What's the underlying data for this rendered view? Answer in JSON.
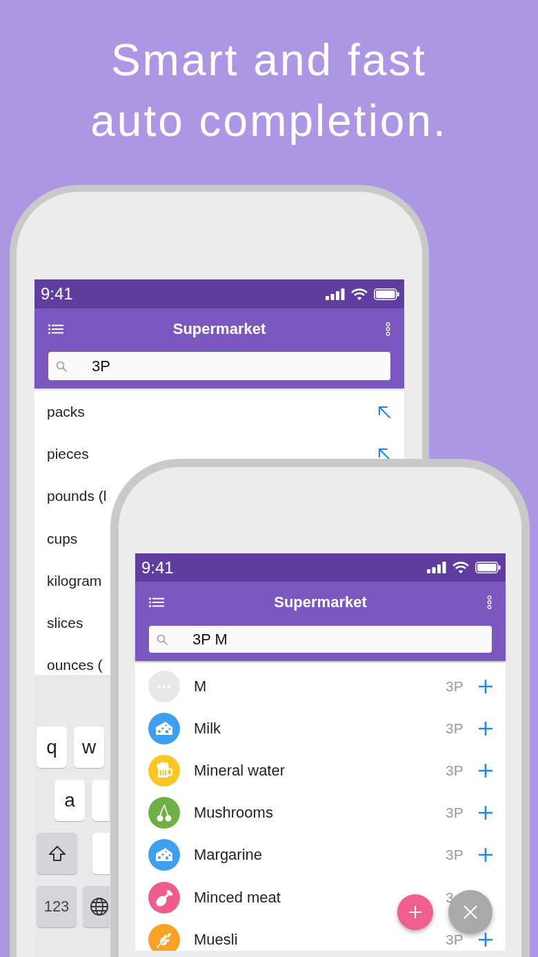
{
  "headline": "Smart and fast auto completion.",
  "back_phone": {
    "status_bar": {
      "time": "9:41"
    },
    "app_bar": {
      "title": "Supermarket"
    },
    "search": {
      "value": "3P"
    },
    "suggestions": [
      {
        "label": "packs",
        "arrow": true
      },
      {
        "label": "pieces",
        "arrow": true
      },
      {
        "label": "pounds (l",
        "arrow": false
      },
      {
        "label": "cups",
        "arrow": false
      },
      {
        "label": "kilogram",
        "arrow": false
      },
      {
        "label": "slices",
        "arrow": false
      },
      {
        "label": "ounces (",
        "arrow": false
      }
    ],
    "keyboard": {
      "rows": [
        [
          {
            "kind": "letter",
            "label": "q"
          },
          {
            "kind": "letter",
            "label": "w"
          }
        ],
        [
          {
            "kind": "letter",
            "label": "a"
          },
          {
            "kind": "blank"
          }
        ],
        [
          {
            "kind": "shift"
          },
          {
            "kind": "blank"
          }
        ],
        [
          {
            "kind": "mode",
            "label": "123"
          },
          {
            "kind": "globe"
          }
        ]
      ]
    }
  },
  "front_phone": {
    "status_bar": {
      "time": "9:41"
    },
    "app_bar": {
      "title": "Supermarket"
    },
    "search": {
      "value": "3P M"
    },
    "items": [
      {
        "kind": "custom",
        "color": "#e8e8e8",
        "name": "M",
        "qty": "3P",
        "plus": true
      },
      {
        "kind": "dairy",
        "color": "#3d9ff0",
        "name": "Milk",
        "qty": "3P",
        "plus": true
      },
      {
        "kind": "drinks",
        "color": "#f9c623",
        "name": "Mineral water",
        "qty": "3P",
        "plus": true
      },
      {
        "kind": "produce",
        "color": "#6faf45",
        "name": "Mushrooms",
        "qty": "3P",
        "plus": true
      },
      {
        "kind": "dairy",
        "color": "#3d9ff0",
        "name": "Margarine",
        "qty": "3P",
        "plus": true
      },
      {
        "kind": "meat",
        "color": "#ec5d8c",
        "name": "Minced meat",
        "qty": "3",
        "plus": false
      },
      {
        "kind": "cereal",
        "color": "#f7a125",
        "name": "Muesli",
        "qty": "3P",
        "plus": true
      }
    ],
    "fabs": [
      {
        "kind": "add"
      },
      {
        "kind": "close"
      }
    ]
  }
}
